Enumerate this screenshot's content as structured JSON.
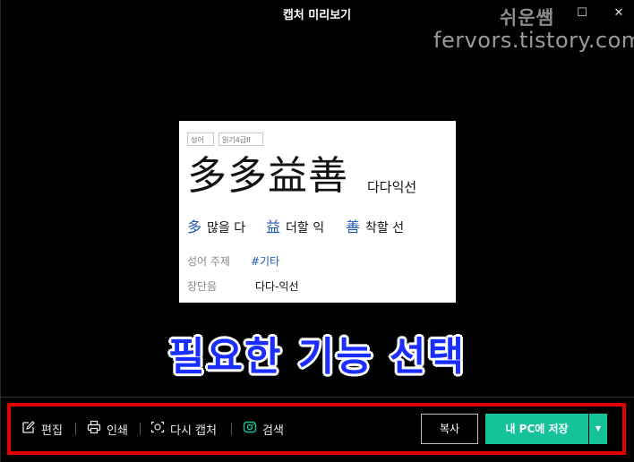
{
  "window": {
    "title": "캡처 미리보기",
    "minimize_glyph": "—",
    "maximize_glyph": "☐",
    "close_glyph": "✕"
  },
  "watermark": {
    "name": "쉬운쌤",
    "url": "fervors.tistory.com"
  },
  "preview": {
    "tags": [
      "성어",
      "읽기4급II"
    ],
    "hanja": "多多益善",
    "reading": "다다익선",
    "characters": [
      {
        "char": "多",
        "meaning": "많을 다"
      },
      {
        "char": "益",
        "meaning": "더할 익"
      },
      {
        "char": "善",
        "meaning": "착할 선"
      }
    ],
    "meta": [
      {
        "label": "성어 주제",
        "value": "#기타"
      },
      {
        "label": "장단음",
        "value": "다다-익선"
      }
    ]
  },
  "overlay": {
    "text": "필요한 기능 선택"
  },
  "toolbar": {
    "edit_label": "편집",
    "print_label": "인쇄",
    "recapture_label": "다시 캡처",
    "search_label": "검색",
    "copy_label": "복사",
    "save_label": "내 PC에 저장",
    "dropdown_glyph": "▼"
  },
  "colors": {
    "accent": "#16c29a",
    "highlight_border": "#e00000",
    "overlay_text": "#1a2fff",
    "hanja_link": "#1f58b0"
  }
}
